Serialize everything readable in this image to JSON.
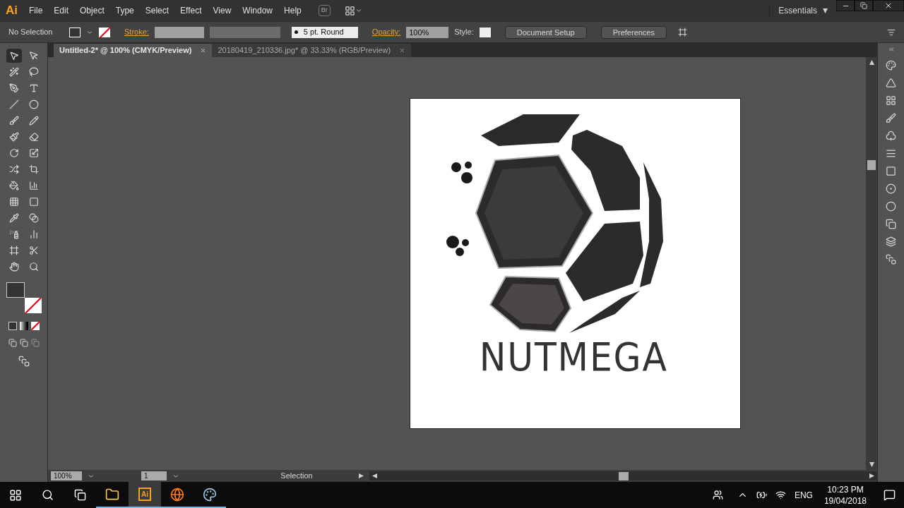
{
  "menu": [
    "File",
    "Edit",
    "Object",
    "Type",
    "Select",
    "Effect",
    "View",
    "Window",
    "Help"
  ],
  "app_logo": "Ai",
  "bridge_button": "Br",
  "workspace": "Essentials",
  "control_bar": {
    "selection": "No Selection",
    "stroke_label": "Stroke:",
    "brush": "5 pt. Round",
    "opacity_label": "Opacity:",
    "opacity": "100%",
    "style_label": "Style:",
    "buttons": [
      "Document Setup",
      "Preferences"
    ]
  },
  "tabs": [
    {
      "label": "Untitled-2* @ 100% (CMYK/Preview)",
      "selected": true
    },
    {
      "label": "20180419_210336.jpg* @ 33.33% (RGB/Preview)",
      "selected": false
    }
  ],
  "tools": [
    {
      "selected": true
    },
    {
      "selected": false
    },
    {
      "selected": false
    },
    {
      "selected": false
    },
    {
      "selected": false
    },
    {
      "selected": false
    },
    {
      "selected": false
    },
    {
      "selected": false
    },
    {
      "selected": false
    },
    {
      "selected": false
    },
    {
      "selected": false
    },
    {
      "selected": false
    },
    {
      "selected": false
    },
    {
      "selected": false
    },
    {
      "selected": false
    },
    {
      "selected": false
    },
    {
      "selected": false
    },
    {
      "selected": false
    },
    {
      "selected": false
    },
    {
      "selected": false
    },
    {
      "selected": false
    },
    {
      "selected": false
    },
    {
      "selected": false
    },
    {
      "selected": false
    },
    {
      "selected": false
    },
    {
      "selected": false
    },
    {
      "selected": false
    },
    {
      "selected": false
    }
  ],
  "artboard": {
    "wordmark": "NUTMEGA"
  },
  "status_bar": {
    "zoom": "100%",
    "artboard": "1",
    "tool": "Selection"
  },
  "taskbar": {
    "apps": [
      {
        "kind": "folder",
        "active": false
      },
      {
        "kind": "illustrator",
        "active": true,
        "label": "Ai"
      },
      {
        "kind": "browser",
        "active": false
      },
      {
        "kind": "paint",
        "active": false
      }
    ],
    "language": "ENG",
    "time": "10:23 PM",
    "date": "19/04/2018"
  }
}
